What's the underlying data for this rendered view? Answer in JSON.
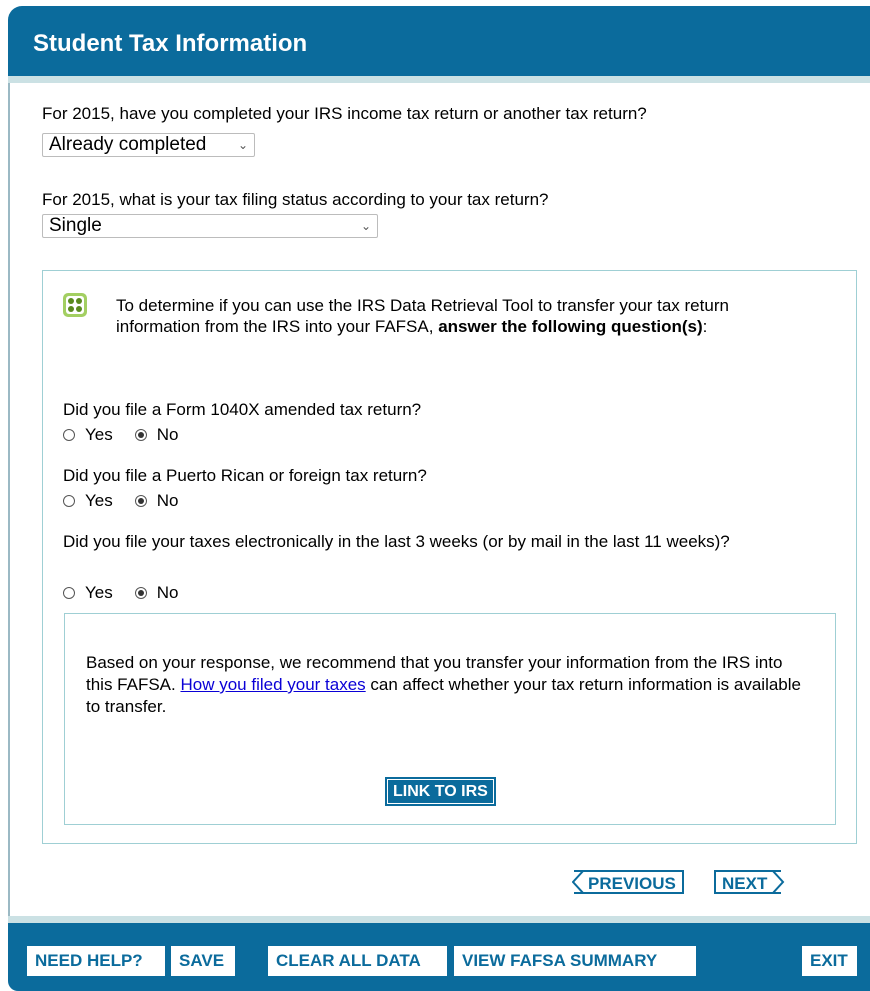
{
  "header": {
    "title": "Student Tax Information"
  },
  "questions": {
    "completed": {
      "label": "For 2015, have you completed your IRS income tax return or another tax return?",
      "value": "Already completed"
    },
    "filing_status": {
      "label": "For 2015, what is your tax filing status according to your tax return?",
      "value": "Single"
    }
  },
  "drt": {
    "intro": "To determine if you can use the IRS Data Retrieval Tool to transfer your tax return information from the IRS into your FAFSA, ",
    "intro_bold": "answer the following question(s)",
    "intro_end": ":",
    "q1": {
      "label": "Did you file a Form 1040X amended tax return?",
      "yes": "Yes",
      "no": "No",
      "selected": "No"
    },
    "q2": {
      "label": "Did you file a Puerto Rican or foreign tax return?",
      "yes": "Yes",
      "no": "No",
      "selected": "No"
    },
    "q3": {
      "label": "Did you file your taxes electronically in the last 3 weeks (or by mail in the last 11 weeks)?",
      "yes": "Yes",
      "no": "No",
      "selected": "No"
    }
  },
  "recommendation": {
    "text_before": "Based on your response, we recommend that you transfer your information from the IRS into this FAFSA. ",
    "link": "How you filed your taxes",
    "text_after": " can affect whether your tax return information is available to transfer.",
    "button": "LINK TO IRS"
  },
  "nav": {
    "previous": "PREVIOUS",
    "next": "NEXT"
  },
  "footer": {
    "need_help": "NEED HELP?",
    "save": "SAVE",
    "clear": "CLEAR ALL DATA",
    "summary": "VIEW FAFSA SUMMARY",
    "exit": "EXIT"
  },
  "colors": {
    "brand": "#0b6b9c",
    "accent": "#a3cf62",
    "border": "#9fcfd4"
  },
  "icons": {
    "drt": "drt-tool-icon",
    "select_arrow": "chevron-down-icon"
  }
}
